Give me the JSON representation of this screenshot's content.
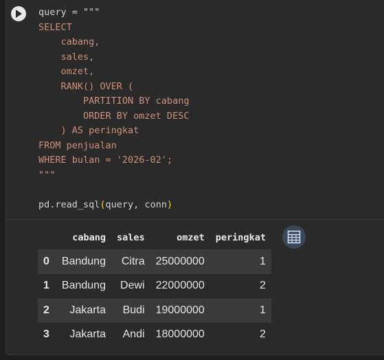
{
  "code": {
    "lines": [
      "query = \"\"\"",
      "SELECT",
      "    cabang,",
      "    sales,",
      "    omzet,",
      "    RANK() OVER (",
      "        PARTITION BY cabang",
      "        ORDER BY omzet DESC",
      "    ) AS peringkat",
      "FROM penjualan",
      "WHERE bulan = '2026-02';",
      "\"\"\"",
      "",
      "pd.read_sql(query, conn)"
    ]
  },
  "table": {
    "columns": [
      "cabang",
      "sales",
      "omzet",
      "peringkat"
    ],
    "rows": [
      {
        "index": "0",
        "cabang": "Bandung",
        "sales": "Citra",
        "omzet": "25000000",
        "peringkat": "1"
      },
      {
        "index": "1",
        "cabang": "Bandung",
        "sales": "Dewi",
        "omzet": "22000000",
        "peringkat": "2"
      },
      {
        "index": "2",
        "cabang": "Jakarta",
        "sales": "Budi",
        "omzet": "19000000",
        "peringkat": "1"
      },
      {
        "index": "3",
        "cabang": "Jakarta",
        "sales": "Andi",
        "omzet": "18000000",
        "peringkat": "2"
      }
    ]
  },
  "icons": {
    "run": "play-icon",
    "table_view": "table-icon"
  },
  "colors": {
    "string": "#ce9178",
    "paren": "#ffd700"
  }
}
